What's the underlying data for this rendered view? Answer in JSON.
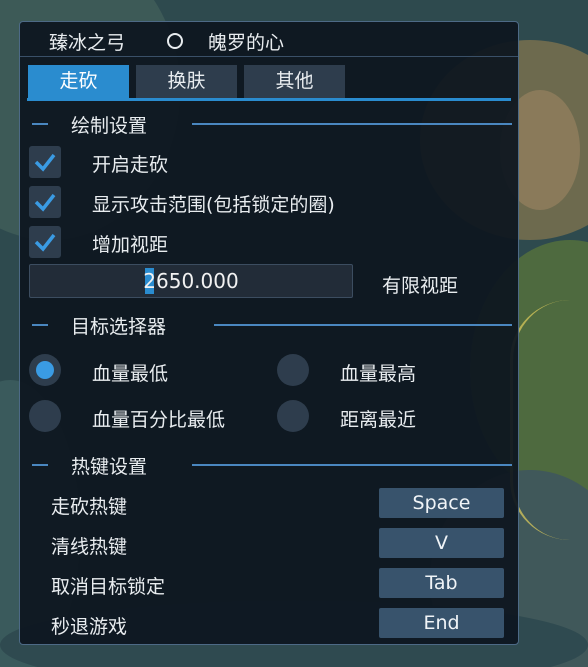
{
  "title": {
    "left": "臻冰之弓",
    "right": "魄罗的心"
  },
  "tabs": [
    {
      "label": "走砍",
      "active": true
    },
    {
      "label": "换肤",
      "active": false
    },
    {
      "label": "其他",
      "active": false
    }
  ],
  "draw_settings": {
    "heading": "绘制设置",
    "options": [
      {
        "label": "开启走砍",
        "checked": true
      },
      {
        "label": "显示攻击范围(包括锁定的圈)",
        "checked": true
      },
      {
        "label": "增加视距",
        "checked": true
      }
    ],
    "view_distance": {
      "value": "2650.000",
      "label": "有限视距"
    }
  },
  "target_selector": {
    "heading": "目标选择器",
    "options": [
      {
        "label": "血量最低",
        "selected": true
      },
      {
        "label": "血量最高",
        "selected": false
      },
      {
        "label": "血量百分比最低",
        "selected": false
      },
      {
        "label": "距离最近",
        "selected": false
      }
    ]
  },
  "hotkeys": {
    "heading": "热键设置",
    "items": [
      {
        "label": "走砍热键",
        "key": "Space"
      },
      {
        "label": "清线热键",
        "key": "V"
      },
      {
        "label": "取消目标锁定",
        "key": "Tab"
      },
      {
        "label": "秒退游戏",
        "key": "End"
      }
    ]
  },
  "colors": {
    "accent": "#2a8ccf",
    "panel": "#0e1620",
    "control": "#2e3d4d",
    "hotkey_button": "#38536c"
  }
}
